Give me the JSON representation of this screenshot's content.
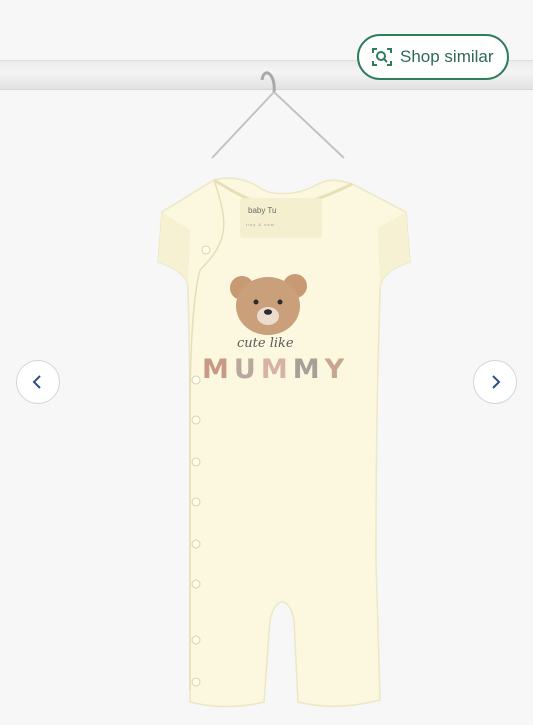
{
  "viewer": {
    "shop_similar_label": "Shop similar"
  },
  "icons": {
    "shop_similar": "image-search-icon",
    "prev": "chevron-left-icon",
    "next": "chevron-right-icon"
  },
  "product_print": {
    "tag_brand": "baby Tu",
    "tag_sub": "tiny & new",
    "script_line": "cute like",
    "headline_letters": [
      "M",
      "U",
      "M",
      "M",
      "Y"
    ]
  },
  "colors": {
    "accent": "#2e7d5b",
    "arrow": "#2f4f8a",
    "garment": "#fbf8df"
  }
}
